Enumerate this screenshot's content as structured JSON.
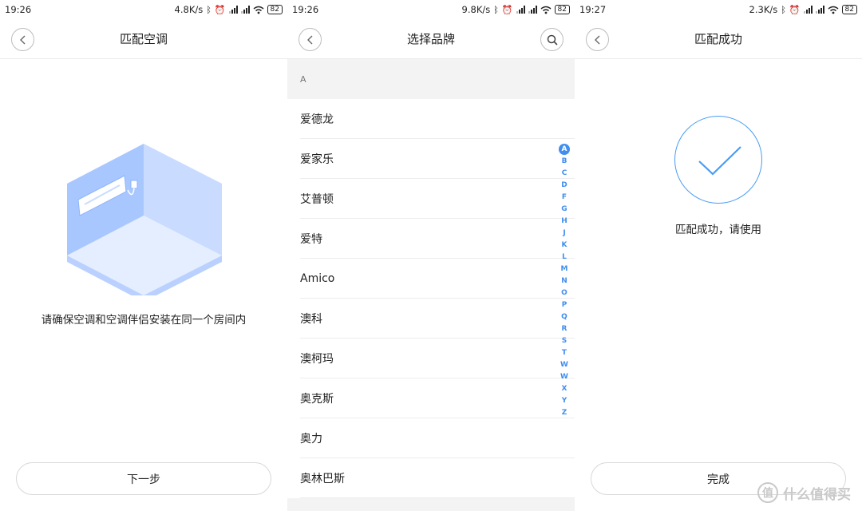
{
  "panels": [
    {
      "status": {
        "time": "19:26",
        "speed": "4.8K/s",
        "battery": "82"
      },
      "title": "匹配空调",
      "instruction": "请确保空调和空调伴侣安装在同一个房间内",
      "button": "下一步"
    },
    {
      "status": {
        "time": "19:26",
        "speed": "9.8K/s",
        "battery": "82"
      },
      "title": "选择品牌",
      "section": "A",
      "brands": [
        "爱德龙",
        "爱家乐",
        "艾普顿",
        "爱特",
        "Amico",
        "澳科",
        "澳柯玛",
        "奥克斯",
        "奥力",
        "奥林巴斯"
      ],
      "index_letters": [
        "A",
        "B",
        "C",
        "D",
        "F",
        "G",
        "H",
        "J",
        "K",
        "L",
        "M",
        "N",
        "O",
        "P",
        "Q",
        "R",
        "S",
        "T",
        "W",
        "W",
        "X",
        "Y",
        "Z"
      ]
    },
    {
      "status": {
        "time": "19:27",
        "speed": "2.3K/s",
        "battery": "82"
      },
      "title": "匹配成功",
      "message": "匹配成功，请使用",
      "button": "完成"
    }
  ],
  "watermark": {
    "logo": "值",
    "text": "什么值得买"
  },
  "colors": {
    "accent": "#3f8ef0",
    "room_light": "#c9dcff",
    "room_mid": "#a9c7ff",
    "room_dark": "#8cb3ff"
  },
  "icons": [
    "back-icon",
    "search-icon",
    "bluetooth-icon",
    "alarm-icon",
    "wifi-icon",
    "checkmark-icon"
  ]
}
